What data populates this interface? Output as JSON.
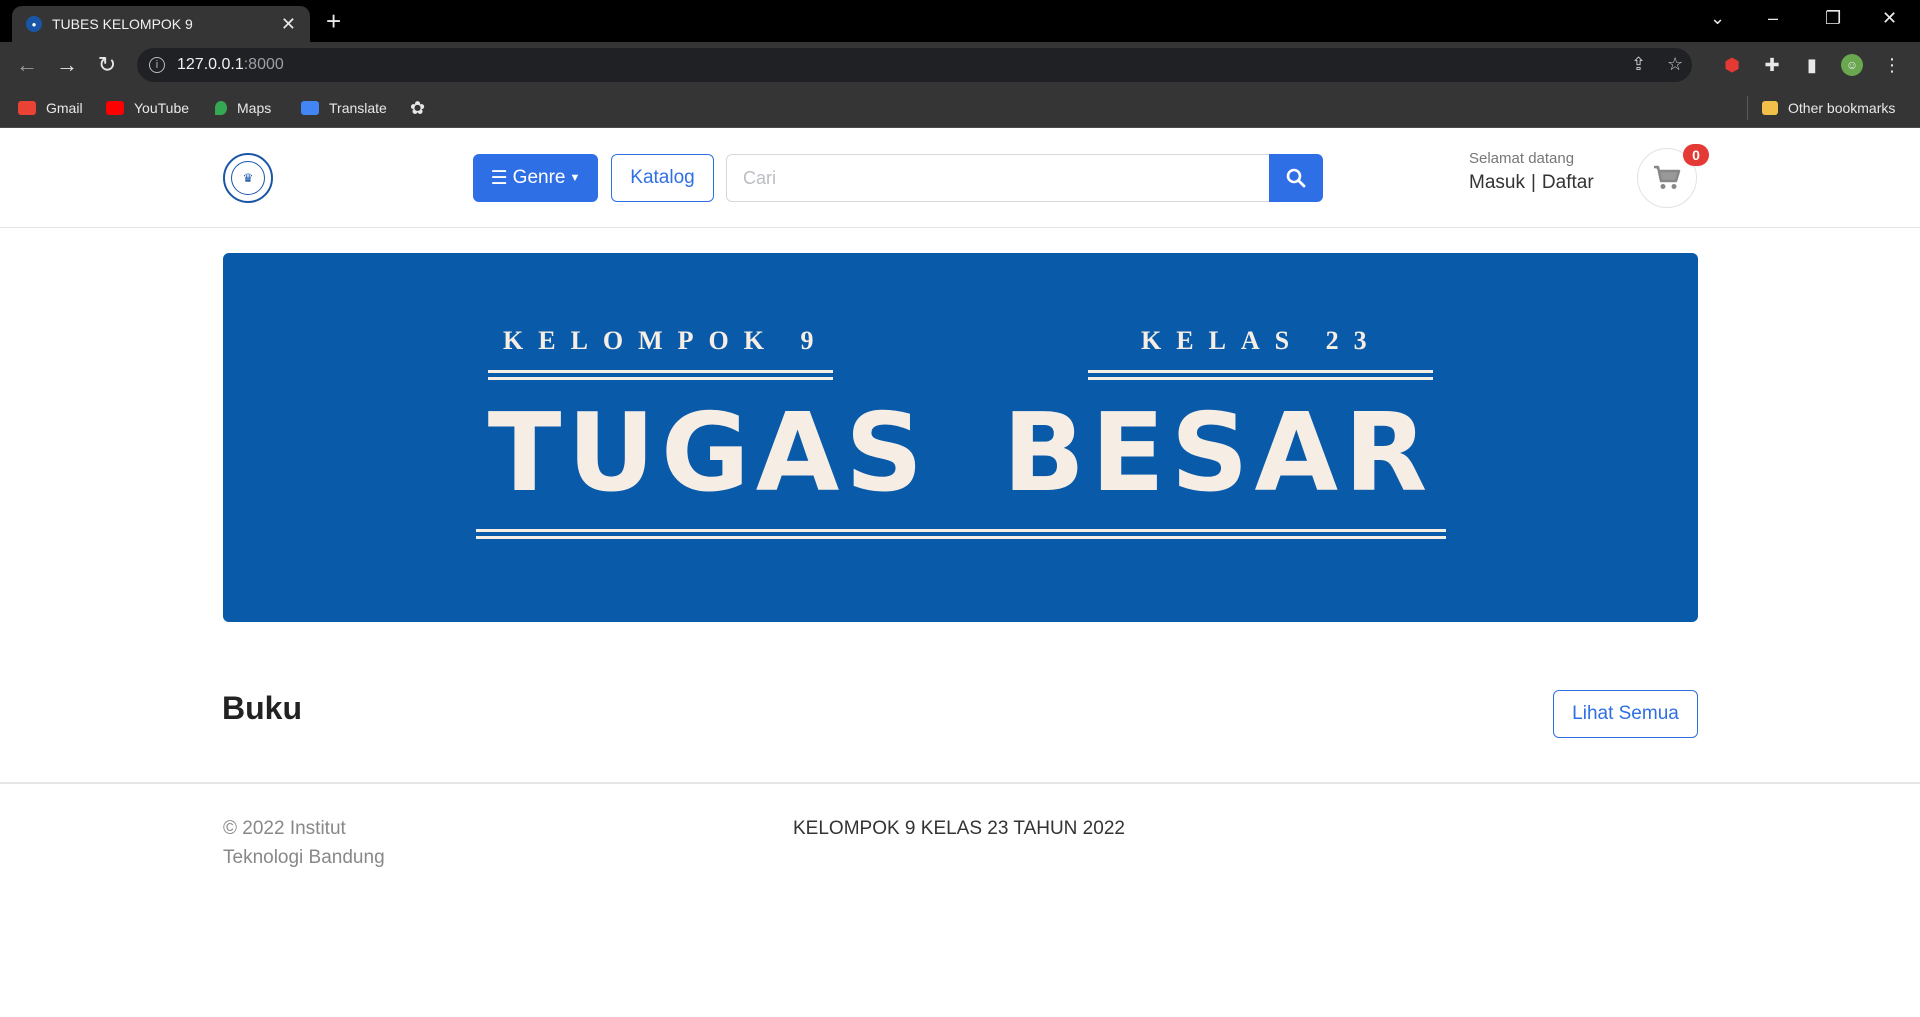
{
  "browser": {
    "tab_title": "TUBES KELOMPOK 9",
    "url_host": "127.0.0.1",
    "url_rest": ":8000",
    "bookmarks": [
      {
        "label": "Gmail",
        "icon": "gmail-icon",
        "color": "#ea4335"
      },
      {
        "label": "YouTube",
        "icon": "youtube-icon",
        "color": "#ff0000"
      },
      {
        "label": "Maps",
        "icon": "maps-icon",
        "color": "#34a853"
      },
      {
        "label": "Translate",
        "icon": "translate-icon",
        "color": "#4285f4"
      }
    ],
    "other_bookmarks": "Other bookmarks"
  },
  "navbar": {
    "genre_label": "Genre",
    "katalog_label": "Katalog",
    "search_placeholder": "Cari",
    "welcome": "Selamat datang",
    "login_label": "Masuk",
    "separator": "|",
    "register_label": "Daftar",
    "cart_count": "0"
  },
  "banner": {
    "left_sub": "KELOMPOK 9",
    "right_sub": "KELAS 23",
    "title": "TUGAS BESAR"
  },
  "section": {
    "title": "Buku",
    "see_all_label": "Lihat Semua"
  },
  "footer": {
    "copyright": "© 2022 Institut Teknologi Bandung",
    "center_text": "KELOMPOK 9 KELAS 23 TAHUN 2022"
  },
  "colors": {
    "primary": "#2f6fe6",
    "banner_bg": "#0a5aaa",
    "badge": "#e53935"
  }
}
